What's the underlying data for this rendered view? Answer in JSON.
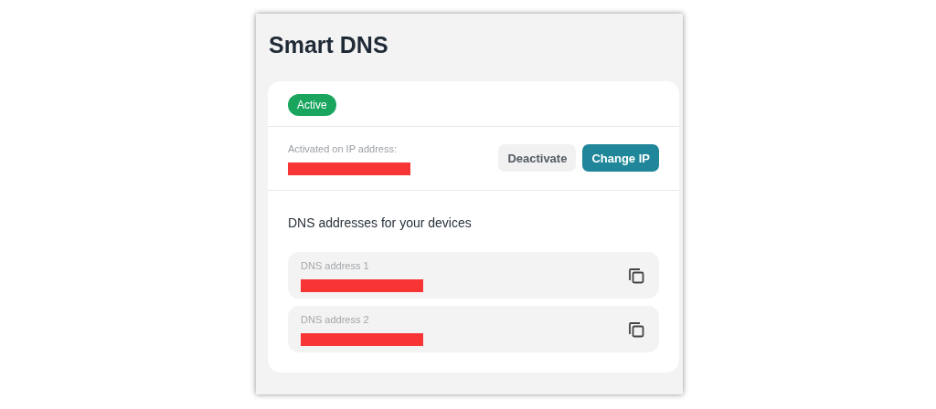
{
  "title": "Smart DNS",
  "status": {
    "label": "Active",
    "kind": "active"
  },
  "activation": {
    "label": "Activated on IP address:",
    "redacted": true
  },
  "buttons": [
    {
      "label": "Deactivate",
      "kind": "secondary"
    },
    {
      "label": "Change IP",
      "kind": "primary"
    }
  ],
  "dns_heading": "DNS addresses for your devices",
  "dns_addresses": [
    {
      "label": "DNS address 1",
      "redacted": true
    },
    {
      "label": "DNS address 2",
      "redacted": true
    }
  ]
}
